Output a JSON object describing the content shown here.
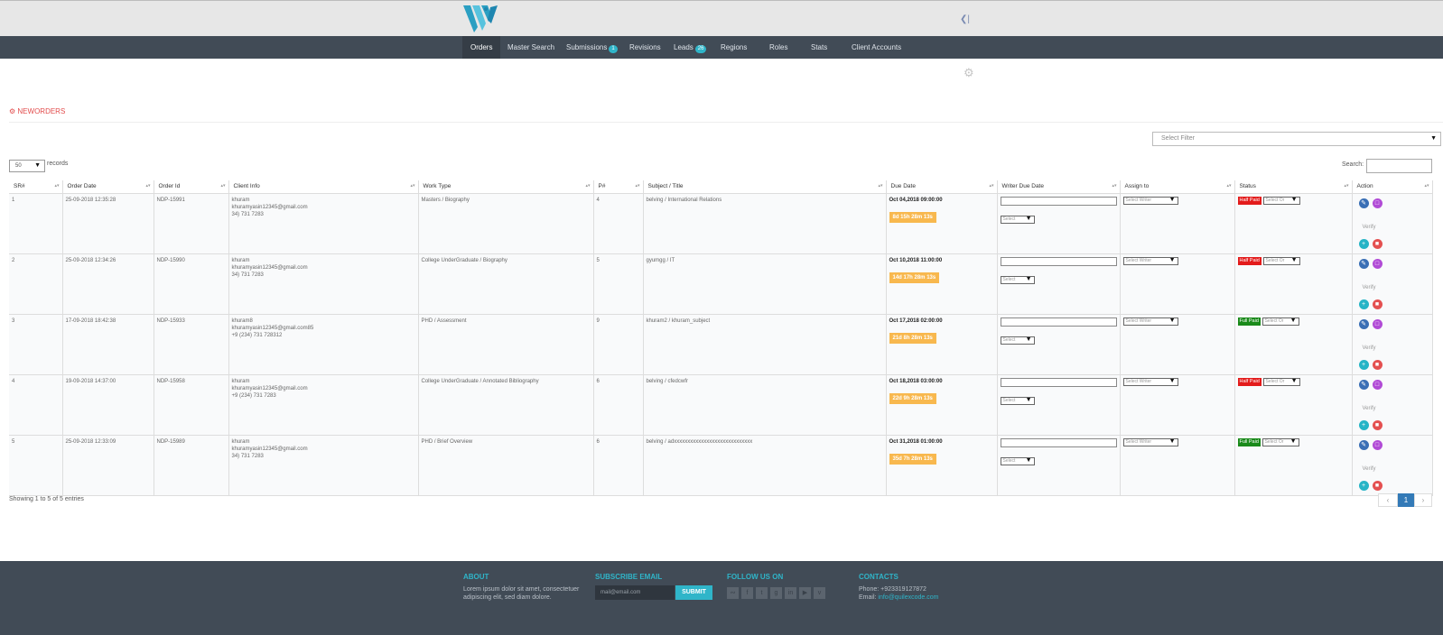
{
  "nav": {
    "items": [
      {
        "label": "Orders",
        "badge": ""
      },
      {
        "label": "Master Search",
        "badge": ""
      },
      {
        "label": "Submissions",
        "badge": "1"
      },
      {
        "label": "Revisions",
        "badge": ""
      },
      {
        "label": "Leads",
        "badge": "26"
      },
      {
        "label": "Regions",
        "badge": ""
      },
      {
        "label": "Roles",
        "badge": ""
      },
      {
        "label": "Stats",
        "badge": ""
      },
      {
        "label": "Client Accounts",
        "badge": ""
      }
    ]
  },
  "section": {
    "title": "NEWORDERS"
  },
  "filter": {
    "placeholder": "Select Filter"
  },
  "records": {
    "value": "50",
    "label": "records"
  },
  "search": {
    "label": "Search:"
  },
  "table": {
    "headers": [
      "SR#",
      "Order Date",
      "Order Id",
      "Client Info",
      "Work Type",
      "P#",
      "Subject / Title",
      "Due Date",
      "Writer Due Date",
      "Assign to",
      "Status",
      "Action"
    ],
    "rows": [
      {
        "sr": "1",
        "date": "25-09-2018 12:35:28",
        "id": "NDP-15991",
        "client_name": "khuram",
        "client_email": "khuramyasin12345@gmail.com",
        "client_phone": "34) 731 7283",
        "work_type": "Masters / Biography",
        "pages": "4",
        "subject": "belving / International Relations",
        "due": "Oct 04,2018 09:00:00",
        "timer": "8d 15h 28m 13s",
        "writer_select": "Select Writer",
        "status": "Half Paid",
        "status_kind": "half",
        "status_select": "Select Or"
      },
      {
        "sr": "2",
        "date": "25-09-2018 12:34:26",
        "id": "NDP-15990",
        "client_name": "khuram",
        "client_email": "khuramyasin12345@gmail.com",
        "client_phone": "34) 731 7283",
        "work_type": "College UnderGraduate / Biography",
        "pages": "5",
        "subject": "gyumgg / IT",
        "due": "Oct 10,2018 11:00:00",
        "timer": "14d 17h 28m 13s",
        "writer_select": "Select Writer",
        "status": "Half Paid",
        "status_kind": "half",
        "status_select": "Select Or"
      },
      {
        "sr": "3",
        "date": "17-09-2018 18:42:38",
        "id": "NDP-15933",
        "client_name": "khuram8",
        "client_email": "khuramyasin12345@gmail.com85",
        "client_phone": "+9 (234) 731 728312",
        "work_type": "PHD / Assessment",
        "pages": "9",
        "subject": "khuram2 / khuram_subject",
        "due": "Oct 17,2018 02:00:00",
        "timer": "21d 8h 28m 13s",
        "writer_select": "Select Writer",
        "status": "Full Paid",
        "status_kind": "full",
        "status_select": "Select Or"
      },
      {
        "sr": "4",
        "date": "19-09-2018 14:37:00",
        "id": "NDP-15958",
        "client_name": "khuram",
        "client_email": "khuramyasin12345@gmail.com",
        "client_phone": "+9 (234) 731 7283",
        "work_type": "College UnderGraduate / Annotated Bibliography",
        "pages": "6",
        "subject": "belving / cfedcwfr",
        "due": "Oct 18,2018 03:00:00",
        "timer": "22d 9h 28m 13s",
        "writer_select": "Select Writer",
        "status": "Half Paid",
        "status_kind": "half",
        "status_select": "Select Or"
      },
      {
        "sr": "5",
        "date": "25-09-2018 12:33:09",
        "id": "NDP-15989",
        "client_name": "khuram",
        "client_email": "khuramyasin12345@gmail.com",
        "client_phone": "34) 731 7283",
        "work_type": "PHD / Brief Overview",
        "pages": "6",
        "subject": "belving / adxxxxxxxxxxxxxxxxxxxxxxxxxxxxx",
        "due": "Oct 31,2018 01:00:00",
        "timer": "35d 7h 28m 13s",
        "writer_select": "Select Writer",
        "status": "Full Paid",
        "status_kind": "full",
        "status_select": "Select Or"
      }
    ],
    "writer_due_select": "Select",
    "verify_label": "Verify"
  },
  "pagination": {
    "showing": "Showing 1 to 5 of 5 entries",
    "prev": "‹",
    "page": "1",
    "next": "›"
  },
  "footer": {
    "about_title": "ABOUT",
    "about_text": "Lorem ipsum dolor sit amet, consectetuer adipiscing elit, sed diam dolore.",
    "subscribe_title": "SUBSCRIBE EMAIL",
    "subscribe_placeholder": "mail@email.com",
    "subscribe_button": "SUBMIT",
    "follow_title": "FOLLOW US ON",
    "contacts_title": "CONTACTS",
    "phone": "Phone: +923319127872",
    "email_label": "Email:",
    "email": "info@quilexcode.com"
  },
  "colors": {
    "navbar": "#414b56",
    "accent": "#2fb5c9",
    "timer": "#f8b84e",
    "half_paid": "#e31b1b",
    "full_paid": "#1a8a1a"
  }
}
